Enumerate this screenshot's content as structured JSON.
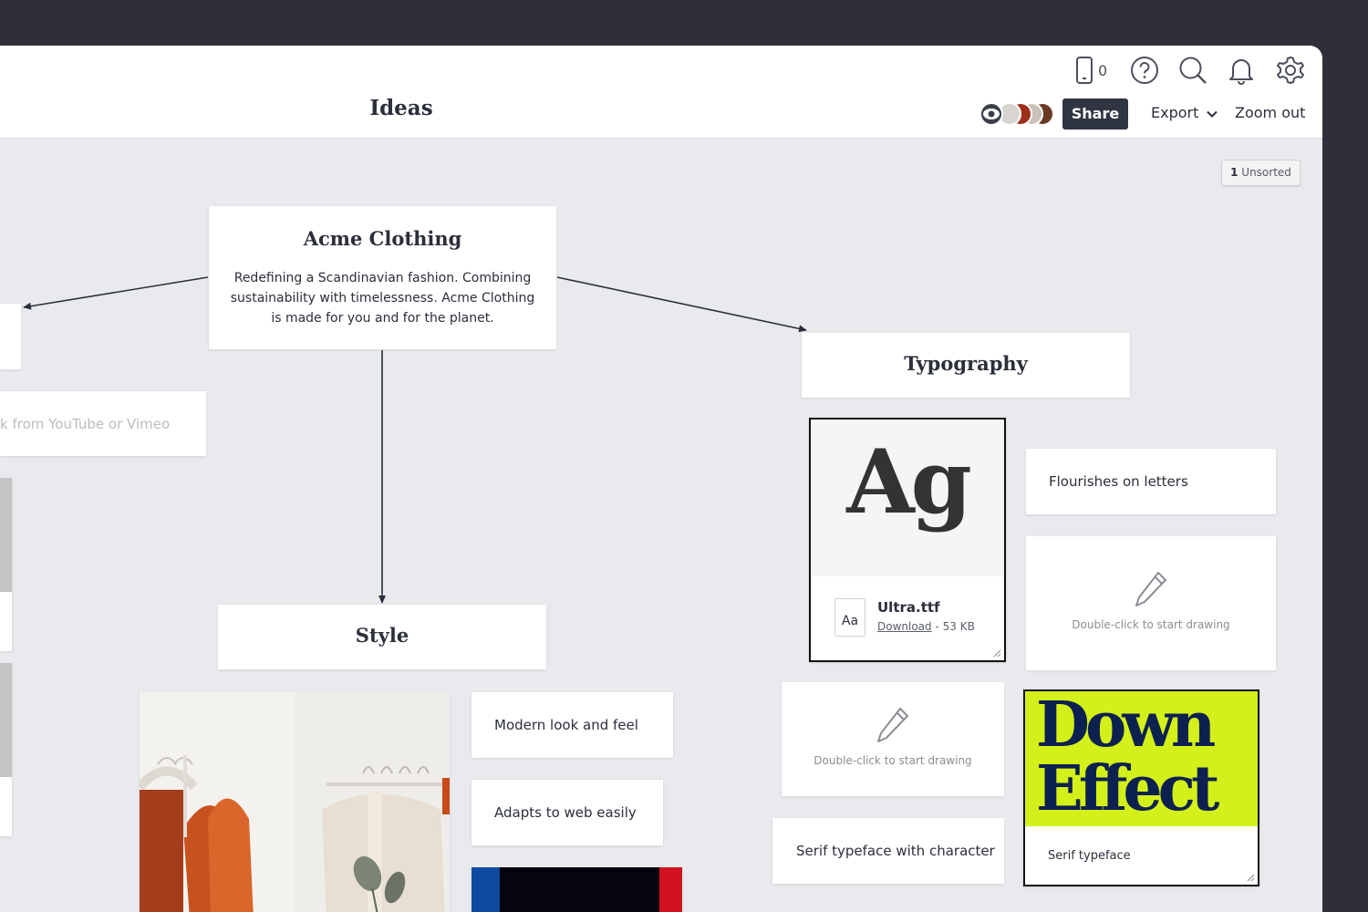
{
  "header": {
    "title": "Ideas",
    "device_count": "0",
    "share_label": "Share",
    "export_label": "Export",
    "zoom_out_label": "Zoom out",
    "icons": [
      "mobile-device-icon",
      "help-icon",
      "search-icon",
      "bell-icon",
      "settings-icon"
    ]
  },
  "unsorted": {
    "count": "1",
    "label": "Unsorted"
  },
  "cards": {
    "main": {
      "title": "Acme Clothing",
      "body": "Redefining a Scandinavian fashion. Combining sustainability with timelessness. Acme Clothing is made for you and for the planet."
    },
    "video_link": {
      "placeholder": "k from YouTube or Vimeo"
    },
    "typography": {
      "title": "Typography"
    },
    "style": {
      "title": "Style"
    },
    "font_file": {
      "preview": "Ag",
      "file_badge": "Aa",
      "filename": "Ultra.ttf",
      "download_label": "Download",
      "size": " - 53 KB"
    },
    "flourishes": {
      "text": "Flourishes on letters"
    },
    "sketch_1": {
      "hint": "Double-click to start drawing"
    },
    "sketch_2": {
      "hint": "Double-click to start drawing"
    },
    "serif_character": {
      "text": "Serif typeface with character"
    },
    "poster": {
      "line1": "Down",
      "line2": "Effect",
      "caption": "Serif typeface",
      "background": "#d4f01a",
      "ink": "#0d2150"
    },
    "modern": {
      "text": "Modern look and feel"
    },
    "adapts": {
      "text": "Adapts to web easily"
    }
  },
  "colors": {
    "frame": "#2f2e39",
    "canvas": "#e9eaed",
    "share_button": "#2f3541",
    "swatch_blue": "#0d4aa0",
    "swatch_black": "#050510",
    "swatch_red": "#d21220"
  }
}
